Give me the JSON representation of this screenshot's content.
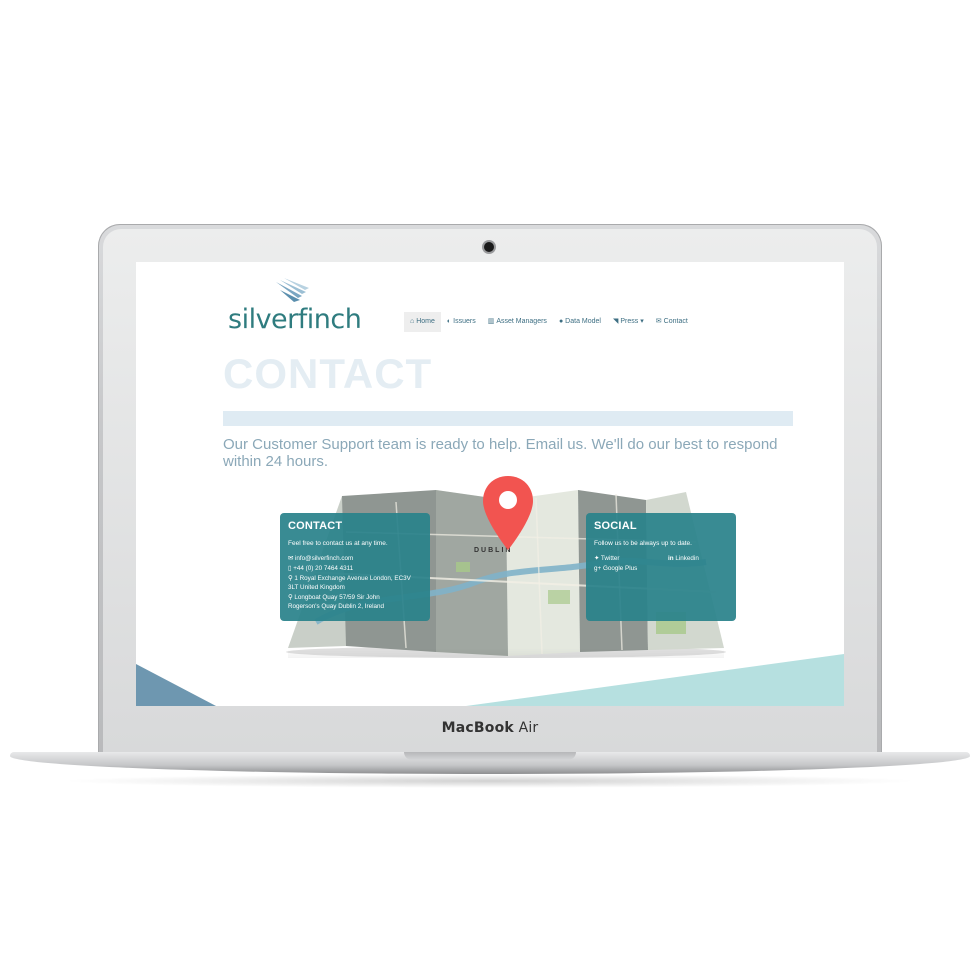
{
  "device": {
    "brand_bold": "MacBook",
    "brand_light": "Air"
  },
  "site": {
    "logo_text": "silverfinch",
    "nav": [
      {
        "label": "Home",
        "icon": "home-icon",
        "glyph": "⌂",
        "active": true
      },
      {
        "label": "Issuers",
        "icon": "shield-icon",
        "glyph": "◐",
        "active": false
      },
      {
        "label": "Asset Managers",
        "icon": "bank-icon",
        "glyph": "▥",
        "active": false
      },
      {
        "label": "Data Model",
        "icon": "globe-icon",
        "glyph": "●",
        "active": false
      },
      {
        "label": "Press",
        "icon": "rss-icon",
        "glyph": "◥",
        "active": false,
        "caret": "▾"
      },
      {
        "label": "Contact",
        "icon": "envelope-icon",
        "glyph": "✉",
        "active": false
      }
    ],
    "page_title": "CONTACT",
    "lead": "Our Customer Support team is ready to help. Email us. We'll do our best to respond within 24 hours.",
    "map_label": "DUBLIN",
    "contact": {
      "heading": "CONTACT",
      "subtitle": "Feel free to contact us at any time.",
      "email": "info@silverfinch.com",
      "phone": "+44 (0) 20 7464 4311",
      "address_london_1": "1 Royal Exchange Avenue London, EC3V",
      "address_london_2": "3LT United Kingdom",
      "address_dublin_1": "Longboat Quay 57/59 Sir John",
      "address_dublin_2": "Rogerson's Quay Dublin 2, Ireland"
    },
    "social": {
      "heading": "SOCIAL",
      "subtitle": "Follow us to be always up to date.",
      "twitter": "Twitter",
      "linkedin": "Linkedin",
      "google": "Google Plus"
    },
    "colors": {
      "teal": "#2a828b",
      "title_fade": "#e4edf3",
      "lead": "#8ba8b8",
      "pin": "#f25450"
    }
  }
}
